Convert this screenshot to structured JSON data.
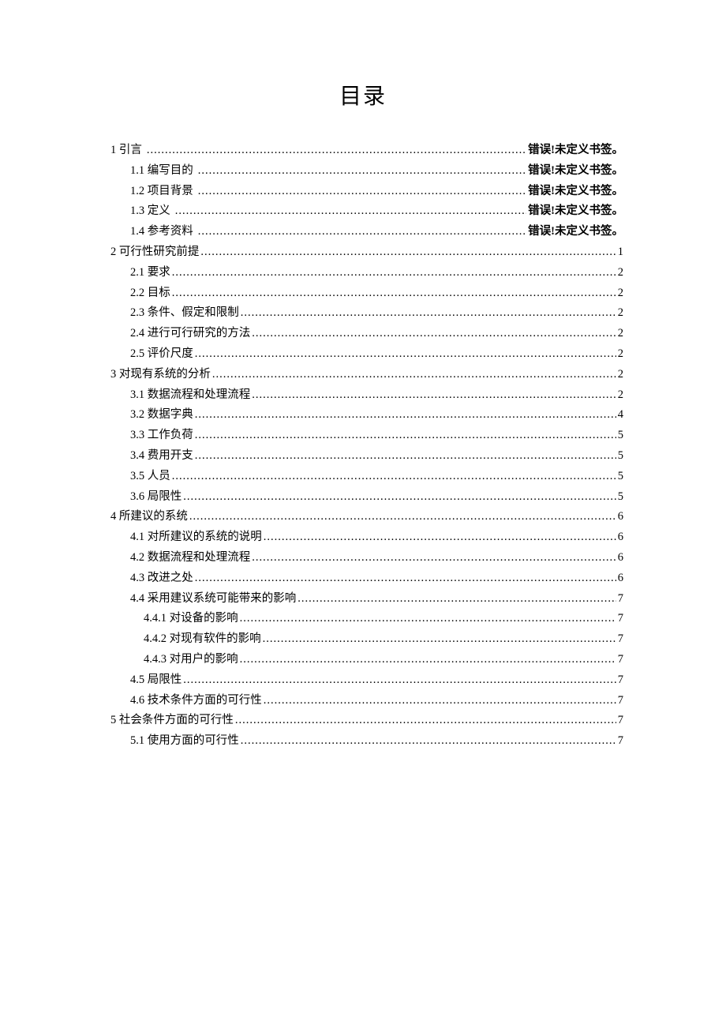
{
  "title": "目录",
  "error_text": "错误!未定义书签。",
  "entries": [
    {
      "level": 0,
      "label": "1 引言",
      "page_type": "error",
      "leader_spaced": true
    },
    {
      "level": 1,
      "label": "1.1 编写目的",
      "page_type": "error",
      "leader_spaced": true
    },
    {
      "level": 1,
      "label": "1.2 项目背景",
      "page_type": "error",
      "leader_spaced": true
    },
    {
      "level": 1,
      "label": "1.3 定义",
      "page_type": "error",
      "leader_spaced": true
    },
    {
      "level": 1,
      "label": "1.4 参考资料",
      "page_type": "error",
      "leader_spaced": true
    },
    {
      "level": 0,
      "label": "2 可行性研究前提",
      "page": "1"
    },
    {
      "level": 1,
      "label": "2.1 要求",
      "page": "2"
    },
    {
      "level": 1,
      "label": "2.2 目标",
      "page": "2"
    },
    {
      "level": 1,
      "label": "2.3 条件、假定和限制",
      "page": "2"
    },
    {
      "level": 1,
      "label": "2.4 进行可行研究的方法",
      "page": "2"
    },
    {
      "level": 1,
      "label": "2.5 评价尺度",
      "page": "2"
    },
    {
      "level": 0,
      "label": "3 对现有系统的分析",
      "page": "2"
    },
    {
      "level": 1,
      "label": "3.1 数据流程和处理流程",
      "page": "2"
    },
    {
      "level": 1,
      "label": "3.2 数据字典",
      "page": "4"
    },
    {
      "level": 1,
      "label": "3.3 工作负荷",
      "page": "5"
    },
    {
      "level": 1,
      "label": "3.4 费用开支",
      "page": "5"
    },
    {
      "level": 1,
      "label": "3.5 人员",
      "page": "5"
    },
    {
      "level": 1,
      "label": "3.6 局限性",
      "page": "5"
    },
    {
      "level": 0,
      "label": "4 所建议的系统",
      "page": "6"
    },
    {
      "level": 1,
      "label": "4.1 对所建议的系统的说明",
      "page": "6"
    },
    {
      "level": 1,
      "label": "4.2 数据流程和处理流程",
      "page": "6"
    },
    {
      "level": 1,
      "label": "4.3 改进之处",
      "page": "6"
    },
    {
      "level": 1,
      "label": "4.4 采用建议系统可能带来的影响",
      "page": "7"
    },
    {
      "level": 2,
      "label": "4.4.1 对设备的影响",
      "page": "7"
    },
    {
      "level": 2,
      "label": "4.4.2 对现有软件的影响",
      "page": "7"
    },
    {
      "level": 2,
      "label": "4.4.3 对用户的影响",
      "page": "7"
    },
    {
      "level": 1,
      "label": "4.5 局限性",
      "page": "7"
    },
    {
      "level": 1,
      "label": "4.6 技术条件方面的可行性",
      "page": "7"
    },
    {
      "level": 0,
      "label": "5 社会条件方面的可行性",
      "page": "7"
    },
    {
      "level": 1,
      "label": "5.1 使用方面的可行性",
      "page": "7"
    }
  ]
}
